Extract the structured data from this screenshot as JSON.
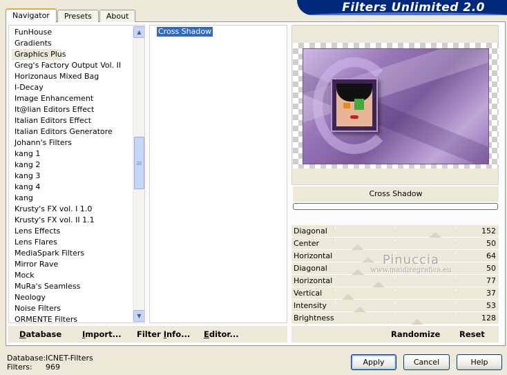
{
  "banner": {
    "title": "Filters Unlimited 2.0"
  },
  "tabs": [
    {
      "label": "Navigator",
      "active": true
    },
    {
      "label": "Presets",
      "active": false
    },
    {
      "label": "About",
      "active": false
    }
  ],
  "categories": {
    "items": [
      "FunHouse",
      "Gradients",
      "Graphics Plus",
      "Greg's Factory Output Vol. II",
      "Horizonaus Mixed Bag",
      "I-Decay",
      "Image Enhancement",
      "It@lian Editors Effect",
      "Italian Editors Effect",
      "Italian Editors Generatore",
      "Johann's Filters",
      "kang 1",
      "kang 2",
      "kang 3",
      "kang 4",
      "kang",
      "Krusty's FX vol. I 1.0",
      "Krusty's FX vol. II 1.1",
      "Lens Effects",
      "Lens Flares",
      "MediaSpark Filters",
      "Mirror Rave",
      "Mock",
      "MuRa's Seamless",
      "Neology",
      "Noise Filters",
      "ORMENTE Filters"
    ],
    "selected": "Graphics Plus",
    "scroll_position": 0.45
  },
  "filters": {
    "items": [
      "Cross Shadow"
    ],
    "selected": "Cross Shadow"
  },
  "preview": {
    "filter_name": "Cross Shadow",
    "progress": 0
  },
  "sliders": [
    {
      "label": "Diagonal",
      "value": "152",
      "level": 152
    },
    {
      "label": "Center",
      "value": "50",
      "level": 50
    },
    {
      "label": "Horizontal",
      "value": "64",
      "level": 64
    },
    {
      "label": "Diagonal",
      "value": "50",
      "level": 50
    },
    {
      "label": "Horizontal",
      "value": "77",
      "level": 77
    },
    {
      "label": "Vertical",
      "value": "37",
      "level": 37
    },
    {
      "label": "Intensity",
      "value": "53",
      "level": 53
    },
    {
      "label": "Brightness",
      "value": "128",
      "level": 128
    }
  ],
  "watermark": {
    "line1": "Pinuccia",
    "line2": "www.maidiregrafica.eu"
  },
  "actions_left": {
    "database": {
      "u": "D",
      "rest": "atabase"
    },
    "import": {
      "u": "I",
      "rest": "mport..."
    },
    "filter_info": {
      "pre": "Filter ",
      "u": "I",
      "rest": "nfo..."
    },
    "editor": {
      "u": "E",
      "rest": "ditor..."
    }
  },
  "actions_right": {
    "randomize": "Randomize",
    "reset": "Reset"
  },
  "status": {
    "database_label": "Database:",
    "database_value": "ICNET-Filters",
    "filters_label": "Filters:",
    "filters_value": "969"
  },
  "buttons": {
    "apply": "Apply",
    "cancel": "Cancel",
    "help": "Help"
  },
  "colors": {
    "banner": "#00287a",
    "selection": "#316ac5",
    "button_border": "#003c74"
  }
}
